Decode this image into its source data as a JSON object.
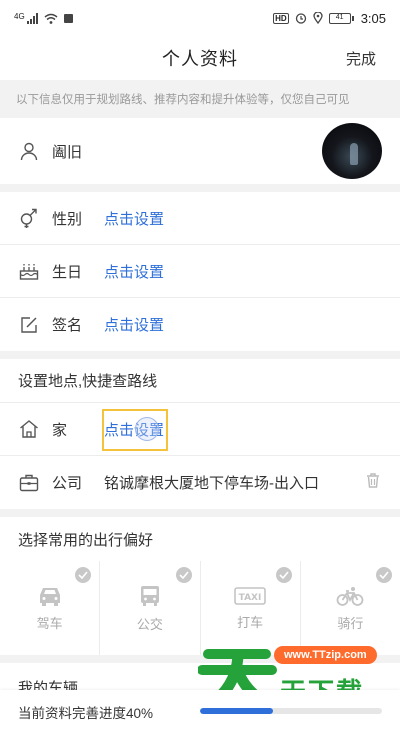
{
  "status_bar": {
    "network": "4G",
    "hd": "HD",
    "battery": "41",
    "time": "3:05"
  },
  "header": {
    "title": "个人资料",
    "done_label": "完成"
  },
  "notice": "以下信息仅用于规划路线、推荐内容和提升体验等，仅您自己可见",
  "profile": {
    "nickname": "阖旧"
  },
  "details": [
    {
      "icon": "gender-icon",
      "label": "性别",
      "value": "点击设置"
    },
    {
      "icon": "birthday-cake-icon",
      "label": "生日",
      "value": "点击设置"
    },
    {
      "icon": "signature-edit-icon",
      "label": "签名",
      "value": "点击设置"
    }
  ],
  "places": {
    "title": "设置地点,快捷查路线",
    "home": {
      "label": "家",
      "value": "点击设置"
    },
    "work": {
      "label": "公司",
      "value": "铭诚摩根大厦地下停车场-出入口"
    }
  },
  "travel": {
    "title": "选择常用的出行偏好",
    "modes": [
      {
        "icon": "car-icon",
        "label": "驾车"
      },
      {
        "icon": "bus-icon",
        "label": "公交"
      },
      {
        "icon": "taxi-icon",
        "label": "打车"
      },
      {
        "icon": "bicycle-icon",
        "label": "骑行"
      }
    ]
  },
  "vehicle_section": {
    "title": "我的车辆"
  },
  "progress": {
    "label": "当前资料完善进度40%",
    "value": 0.4
  },
  "watermark": {
    "url": "www.TTzip.com",
    "text": "天下载"
  },
  "colors": {
    "accent": "#2f6fd9",
    "highlight": "#f5c33b",
    "watermark_green": "#25a33a",
    "watermark_orange": "#ff6b2c"
  }
}
